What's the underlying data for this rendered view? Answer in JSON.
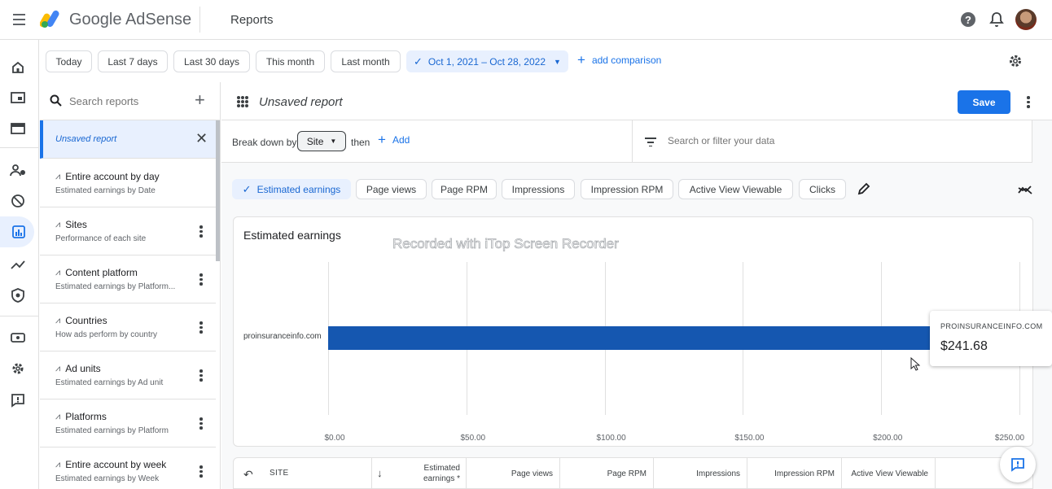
{
  "header": {
    "product": "Google AdSense",
    "section": "Reports"
  },
  "date_filters": [
    "Today",
    "Last 7 days",
    "Last 30 days",
    "This month",
    "Last month"
  ],
  "date_range": "Oct 1, 2021 – Oct 28, 2022",
  "add_comparison": "add comparison",
  "sidebar": {
    "search_placeholder": "Search reports",
    "active_report": "Unsaved report",
    "items": [
      {
        "title": "Entire account by day",
        "subtitle": "Estimated earnings by Date"
      },
      {
        "title": "Sites",
        "subtitle": "Performance of each site"
      },
      {
        "title": "Content platform",
        "subtitle": "Estimated earnings by Platform..."
      },
      {
        "title": "Countries",
        "subtitle": "How ads perform by country"
      },
      {
        "title": "Ad units",
        "subtitle": "Estimated earnings by Ad unit"
      },
      {
        "title": "Platforms",
        "subtitle": "Estimated earnings by Platform"
      },
      {
        "title": "Entire account by week",
        "subtitle": "Estimated earnings by Week"
      }
    ]
  },
  "report": {
    "title": "Unsaved report",
    "save_label": "Save",
    "breakdown_label": "Break down by",
    "breakdown_value": "Site",
    "then_label": "then",
    "add_label": "Add",
    "filter_placeholder": "Search or filter your data"
  },
  "metrics": [
    "Estimated earnings",
    "Page views",
    "Page RPM",
    "Impressions",
    "Impression RPM",
    "Active View Viewable",
    "Clicks"
  ],
  "chart_data": {
    "type": "bar",
    "title": "Estimated earnings",
    "categories": [
      "proinsuranceinfo.com"
    ],
    "values": [
      241.68
    ],
    "xlim": [
      0,
      250
    ],
    "xticks": [
      "$0.00",
      "$50.00",
      "$100.00",
      "$150.00",
      "$200.00",
      "$250.00"
    ],
    "orientation": "horizontal",
    "grid": true,
    "bar_color": "#1557b0"
  },
  "tooltip": {
    "site": "PROINSURANCEINFO.COM",
    "value": "$241.68"
  },
  "watermark": "Recorded with iTop Screen Recorder",
  "table": {
    "columns": [
      "SITE",
      "Estimated earnings *",
      "Page views",
      "Page RPM",
      "Impressions",
      "Impression RPM",
      "Active View Viewable"
    ]
  },
  "colors": {
    "accent": "#1a73e8",
    "chip_selected_bg": "#e8f0fe"
  }
}
